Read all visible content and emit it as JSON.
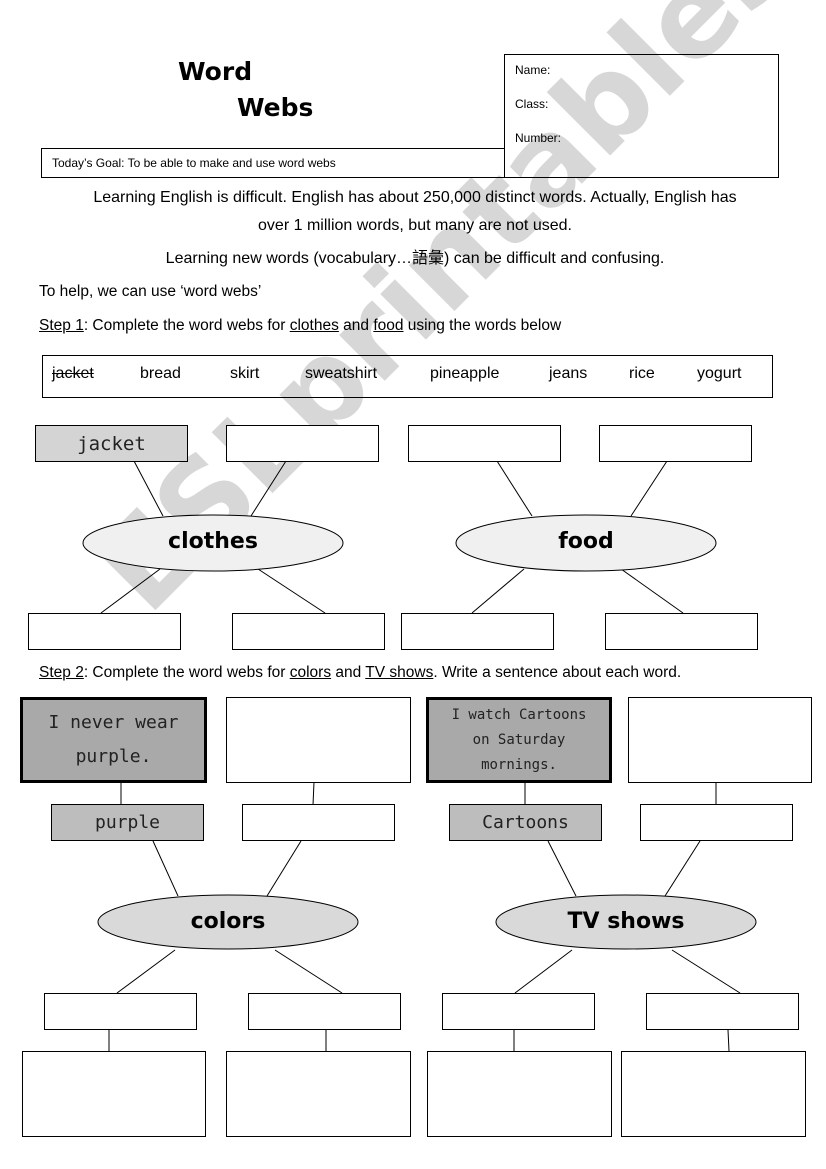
{
  "header": {
    "title_line1": "Word",
    "title_line2": "Webs",
    "goal": "Today’s Goal: To be able to make and use word webs",
    "info_fields": [
      "Name:",
      "Class:",
      "Number:"
    ]
  },
  "intro": {
    "line1": "Learning English is difficult. English has about 250,000 distinct words. Actually, English has",
    "line2": "over 1 million words, but many are not used.",
    "line3": "Learning new words (vocabulary…語彙) can be difficult and confusing.",
    "help": "To help, we can use ‘word webs’"
  },
  "step1": {
    "label": "Step 1",
    "text_a": ": Complete the word webs for ",
    "topic1": "clothes",
    "text_b": " and ",
    "topic2": "food",
    "text_c": " using the words below",
    "word_bank": [
      {
        "word": "jacket",
        "used": true
      },
      {
        "word": "bread",
        "used": false
      },
      {
        "word": "skirt",
        "used": false
      },
      {
        "word": "sweatshirt",
        "used": false
      },
      {
        "word": "pineapple",
        "used": false
      },
      {
        "word": "jeans",
        "used": false
      },
      {
        "word": "rice",
        "used": false
      },
      {
        "word": "yogurt",
        "used": false
      }
    ],
    "webs": [
      {
        "center": "clothes",
        "boxes": [
          "jacket",
          "",
          "",
          ""
        ]
      },
      {
        "center": "food",
        "boxes": [
          "",
          "",
          "",
          ""
        ]
      }
    ]
  },
  "step2": {
    "label": "Step 2",
    "text_a": ": Complete the word webs for ",
    "topic1": "colors",
    "text_b": " and ",
    "topic2": "TV shows",
    "text_c": ". Write a sentence about each word.",
    "webs": [
      {
        "center": "colors",
        "words": [
          "purple",
          "",
          "",
          ""
        ],
        "sentences": [
          "I never wear purple.",
          "",
          "",
          ""
        ]
      },
      {
        "center": "TV shows",
        "words": [
          "Cartoons",
          "",
          "",
          ""
        ],
        "sentences": [
          "I watch Cartoons on Saturday mornings.",
          "",
          "",
          ""
        ]
      }
    ]
  },
  "watermark": "ESLprintables.com"
}
